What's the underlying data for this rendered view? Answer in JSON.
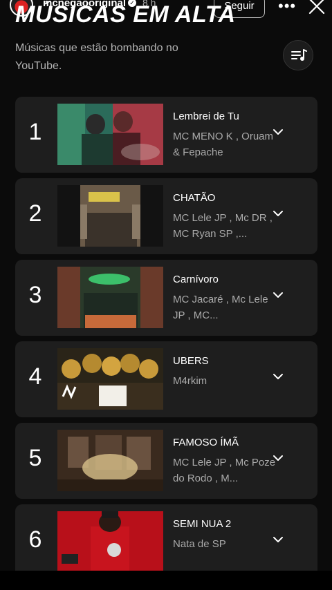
{
  "story": {
    "username": "mcnegaooriginal",
    "time": "8 h",
    "follow_label": "Seguir"
  },
  "header": {
    "title": "MÚSICAS EM ALTA",
    "subtitle": "Músicas que estão bombando no YouTube."
  },
  "songs": [
    {
      "rank": "1",
      "title": "Lembrei de Tu",
      "artists": "MC MENO K , Oruam & Fepache"
    },
    {
      "rank": "2",
      "title": "CHATÃO",
      "artists": "MC Lele JP , Mc DR , MC Ryan SP ,..."
    },
    {
      "rank": "3",
      "title": "Carnívoro",
      "artists": "MC Jacaré , Mc Lele JP , MC..."
    },
    {
      "rank": "4",
      "title": "UBERS",
      "artists": "M4rkim"
    },
    {
      "rank": "5",
      "title": "FAMOSO ÍMÃ",
      "artists": "MC Lele JP , Mc Poze do Rodo , M..."
    },
    {
      "rank": "6",
      "title": "SEMI NUA 2",
      "artists": "Nata de SP"
    }
  ],
  "colors": {
    "background": "#0b0b0b",
    "card": "#1e1e1e",
    "secondary_text": "#aaaaaa"
  }
}
